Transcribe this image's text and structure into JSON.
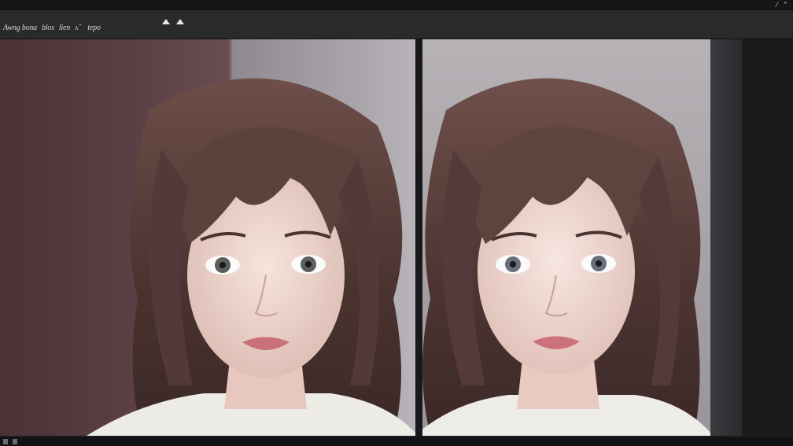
{
  "titlebar": {
    "controls": [
      "⁄",
      "⌃"
    ],
    "icons": [
      "minimize-icon",
      "close-icon"
    ]
  },
  "toolbar": {
    "menu": [
      {
        "label": "Awng bona"
      },
      {
        "label": "blos"
      },
      {
        "label": "lien"
      },
      {
        "label": "ʌ̃"
      },
      {
        "label": "tepo"
      }
    ],
    "arrows": [
      "arrow-up-icon",
      "arrow-up-icon"
    ]
  },
  "panels": {
    "left": {
      "image": "portrait-original"
    },
    "right": {
      "image": "portrait-variation"
    }
  },
  "colors": {
    "chrome": "#2a2a2d",
    "workspace": "#1b1b1d",
    "hair": "#5a3f3a",
    "skin": "#f0d9d2"
  }
}
